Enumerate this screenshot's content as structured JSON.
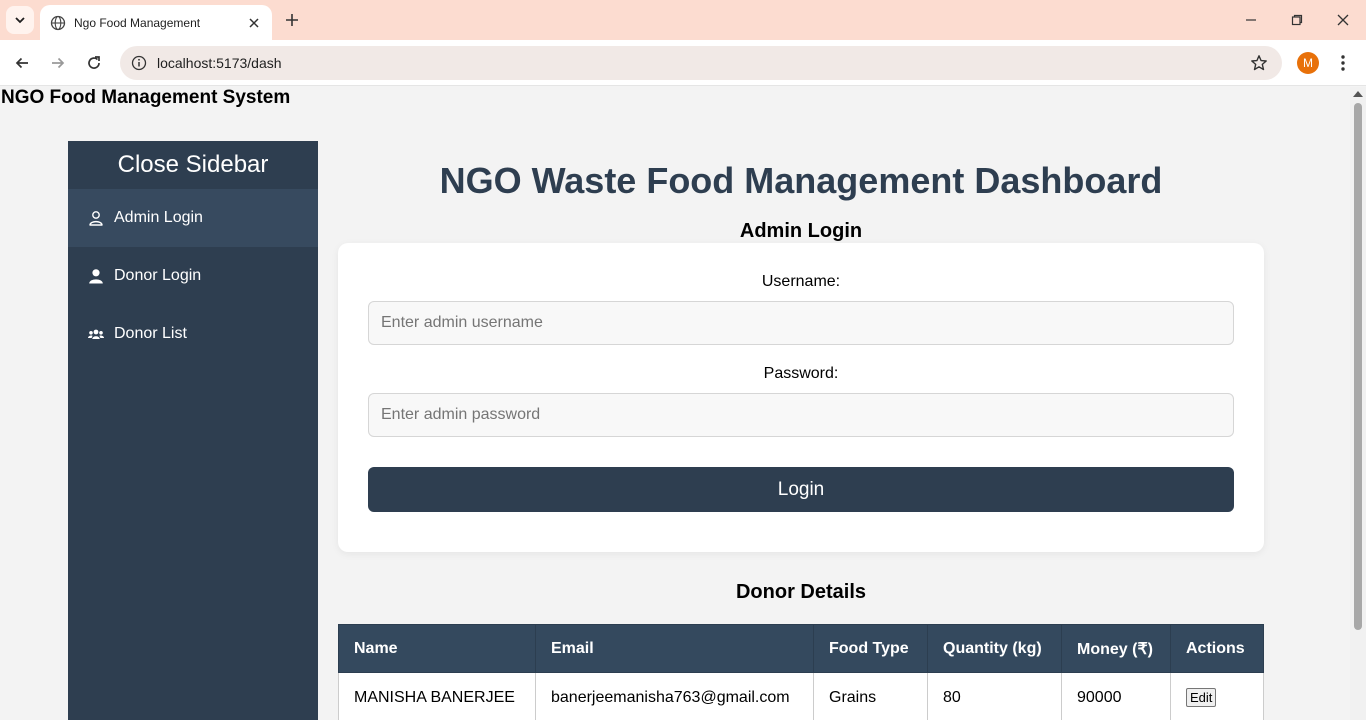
{
  "browser": {
    "tab_title": "Ngo Food Management",
    "url": "localhost:5173/dash",
    "profile_initial": "M"
  },
  "site": {
    "title": "NGO Food Management System"
  },
  "sidebar": {
    "close_label": "Close Sidebar",
    "items": [
      {
        "label": "Admin Login",
        "icon": "user-outline-icon",
        "active": true
      },
      {
        "label": "Donor Login",
        "icon": "user-solid-icon",
        "active": false
      },
      {
        "label": "Donor List",
        "icon": "users-icon",
        "active": false
      }
    ]
  },
  "main": {
    "dashboard_title": "NGO Waste Food Management Dashboard",
    "login": {
      "heading": "Admin Login",
      "username_label": "Username:",
      "username_placeholder": "Enter admin username",
      "password_label": "Password:",
      "password_placeholder": "Enter admin password",
      "submit_label": "Login"
    },
    "donors": {
      "heading": "Donor Details",
      "columns": [
        "Name",
        "Email",
        "Food Type",
        "Quantity (kg)",
        "Money (₹)",
        "Actions"
      ],
      "rows": [
        {
          "name": "MANISHA BANERJEE",
          "email": "banerjeemanisha763@gmail.com",
          "food_type": "Grains",
          "quantity": "80",
          "money": "90000",
          "action": "Edit"
        }
      ]
    }
  },
  "colors": {
    "sidebar_bg": "#2e3e50",
    "sidebar_active": "#374a5f",
    "primary": "#2e3e50",
    "table_header": "#34495e",
    "tabbar_bg": "#fcdcd0"
  }
}
